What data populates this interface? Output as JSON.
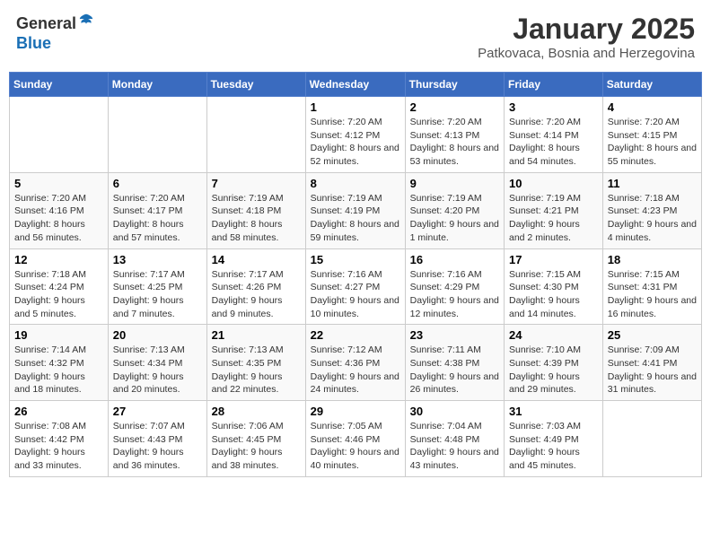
{
  "header": {
    "logo_line1": "General",
    "logo_line2": "Blue",
    "month_title": "January 2025",
    "location": "Patkovaca, Bosnia and Herzegovina"
  },
  "days_of_week": [
    "Sunday",
    "Monday",
    "Tuesday",
    "Wednesday",
    "Thursday",
    "Friday",
    "Saturday"
  ],
  "weeks": [
    [
      {
        "day": "",
        "info": ""
      },
      {
        "day": "",
        "info": ""
      },
      {
        "day": "",
        "info": ""
      },
      {
        "day": "1",
        "info": "Sunrise: 7:20 AM\nSunset: 4:12 PM\nDaylight: 8 hours and 52 minutes."
      },
      {
        "day": "2",
        "info": "Sunrise: 7:20 AM\nSunset: 4:13 PM\nDaylight: 8 hours and 53 minutes."
      },
      {
        "day": "3",
        "info": "Sunrise: 7:20 AM\nSunset: 4:14 PM\nDaylight: 8 hours and 54 minutes."
      },
      {
        "day": "4",
        "info": "Sunrise: 7:20 AM\nSunset: 4:15 PM\nDaylight: 8 hours and 55 minutes."
      }
    ],
    [
      {
        "day": "5",
        "info": "Sunrise: 7:20 AM\nSunset: 4:16 PM\nDaylight: 8 hours and 56 minutes."
      },
      {
        "day": "6",
        "info": "Sunrise: 7:20 AM\nSunset: 4:17 PM\nDaylight: 8 hours and 57 minutes."
      },
      {
        "day": "7",
        "info": "Sunrise: 7:19 AM\nSunset: 4:18 PM\nDaylight: 8 hours and 58 minutes."
      },
      {
        "day": "8",
        "info": "Sunrise: 7:19 AM\nSunset: 4:19 PM\nDaylight: 8 hours and 59 minutes."
      },
      {
        "day": "9",
        "info": "Sunrise: 7:19 AM\nSunset: 4:20 PM\nDaylight: 9 hours and 1 minute."
      },
      {
        "day": "10",
        "info": "Sunrise: 7:19 AM\nSunset: 4:21 PM\nDaylight: 9 hours and 2 minutes."
      },
      {
        "day": "11",
        "info": "Sunrise: 7:18 AM\nSunset: 4:23 PM\nDaylight: 9 hours and 4 minutes."
      }
    ],
    [
      {
        "day": "12",
        "info": "Sunrise: 7:18 AM\nSunset: 4:24 PM\nDaylight: 9 hours and 5 minutes."
      },
      {
        "day": "13",
        "info": "Sunrise: 7:17 AM\nSunset: 4:25 PM\nDaylight: 9 hours and 7 minutes."
      },
      {
        "day": "14",
        "info": "Sunrise: 7:17 AM\nSunset: 4:26 PM\nDaylight: 9 hours and 9 minutes."
      },
      {
        "day": "15",
        "info": "Sunrise: 7:16 AM\nSunset: 4:27 PM\nDaylight: 9 hours and 10 minutes."
      },
      {
        "day": "16",
        "info": "Sunrise: 7:16 AM\nSunset: 4:29 PM\nDaylight: 9 hours and 12 minutes."
      },
      {
        "day": "17",
        "info": "Sunrise: 7:15 AM\nSunset: 4:30 PM\nDaylight: 9 hours and 14 minutes."
      },
      {
        "day": "18",
        "info": "Sunrise: 7:15 AM\nSunset: 4:31 PM\nDaylight: 9 hours and 16 minutes."
      }
    ],
    [
      {
        "day": "19",
        "info": "Sunrise: 7:14 AM\nSunset: 4:32 PM\nDaylight: 9 hours and 18 minutes."
      },
      {
        "day": "20",
        "info": "Sunrise: 7:13 AM\nSunset: 4:34 PM\nDaylight: 9 hours and 20 minutes."
      },
      {
        "day": "21",
        "info": "Sunrise: 7:13 AM\nSunset: 4:35 PM\nDaylight: 9 hours and 22 minutes."
      },
      {
        "day": "22",
        "info": "Sunrise: 7:12 AM\nSunset: 4:36 PM\nDaylight: 9 hours and 24 minutes."
      },
      {
        "day": "23",
        "info": "Sunrise: 7:11 AM\nSunset: 4:38 PM\nDaylight: 9 hours and 26 minutes."
      },
      {
        "day": "24",
        "info": "Sunrise: 7:10 AM\nSunset: 4:39 PM\nDaylight: 9 hours and 29 minutes."
      },
      {
        "day": "25",
        "info": "Sunrise: 7:09 AM\nSunset: 4:41 PM\nDaylight: 9 hours and 31 minutes."
      }
    ],
    [
      {
        "day": "26",
        "info": "Sunrise: 7:08 AM\nSunset: 4:42 PM\nDaylight: 9 hours and 33 minutes."
      },
      {
        "day": "27",
        "info": "Sunrise: 7:07 AM\nSunset: 4:43 PM\nDaylight: 9 hours and 36 minutes."
      },
      {
        "day": "28",
        "info": "Sunrise: 7:06 AM\nSunset: 4:45 PM\nDaylight: 9 hours and 38 minutes."
      },
      {
        "day": "29",
        "info": "Sunrise: 7:05 AM\nSunset: 4:46 PM\nDaylight: 9 hours and 40 minutes."
      },
      {
        "day": "30",
        "info": "Sunrise: 7:04 AM\nSunset: 4:48 PM\nDaylight: 9 hours and 43 minutes."
      },
      {
        "day": "31",
        "info": "Sunrise: 7:03 AM\nSunset: 4:49 PM\nDaylight: 9 hours and 45 minutes."
      },
      {
        "day": "",
        "info": ""
      }
    ]
  ]
}
